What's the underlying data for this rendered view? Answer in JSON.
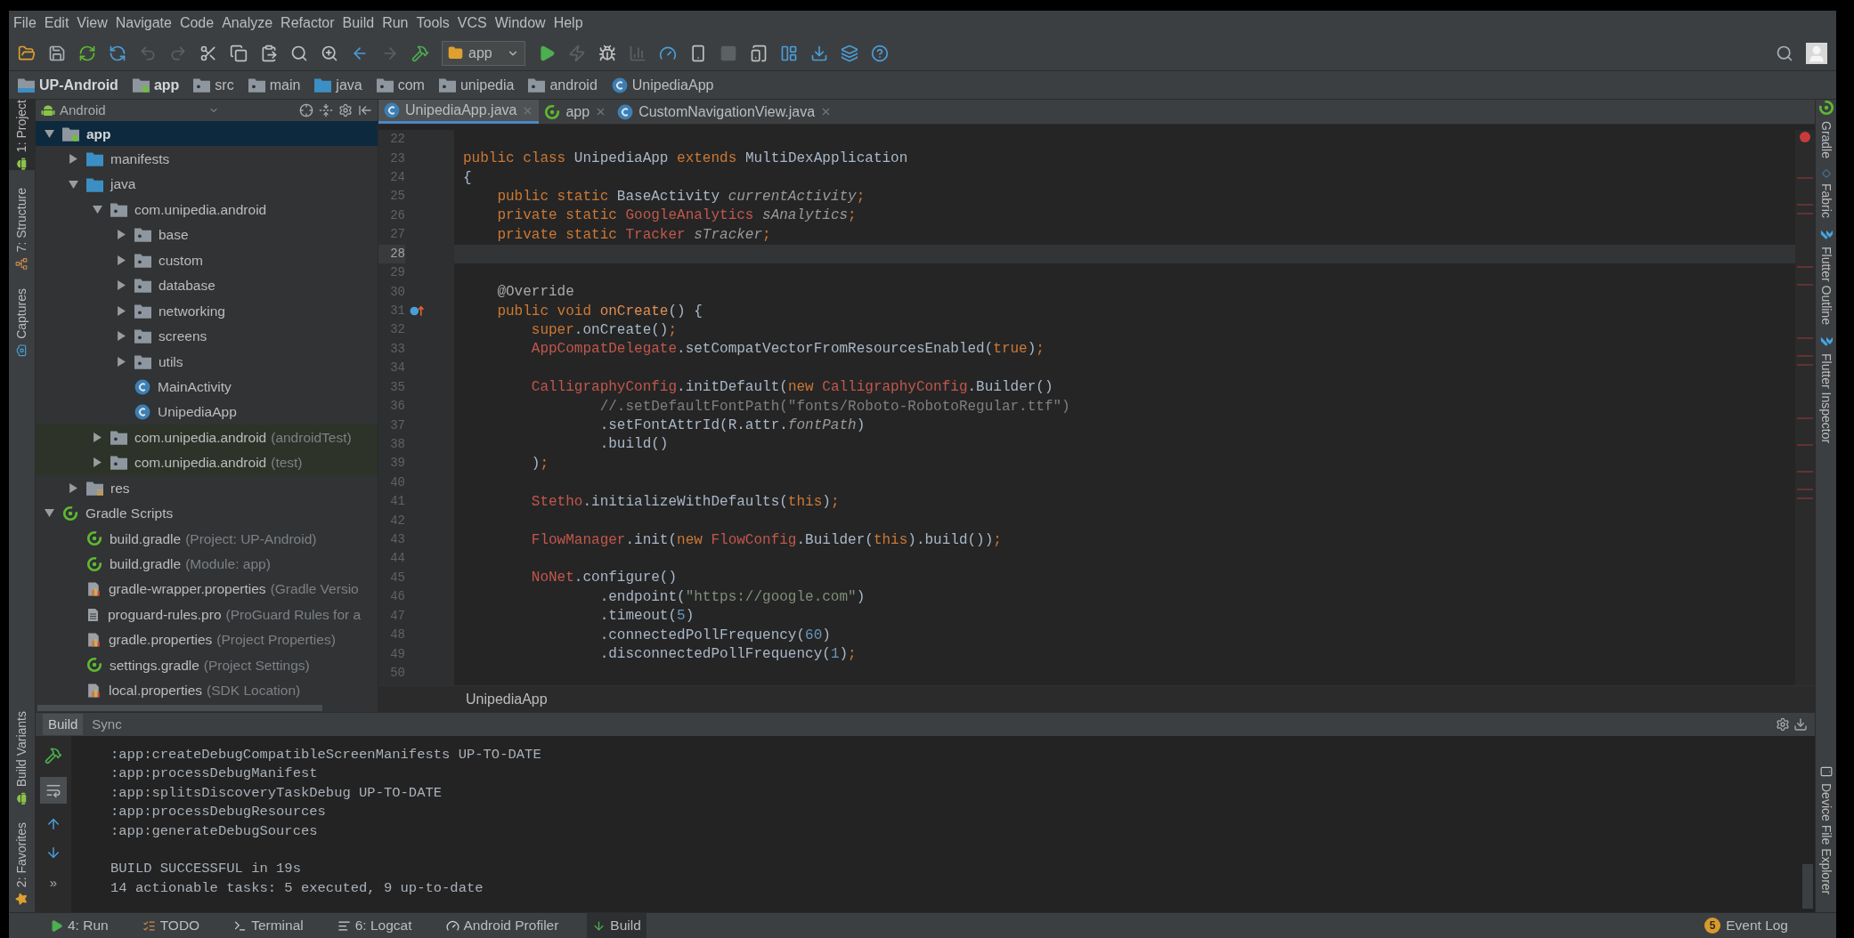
{
  "menu": [
    "File",
    "Edit",
    "View",
    "Navigate",
    "Code",
    "Analyze",
    "Refactor",
    "Build",
    "Run",
    "Tools",
    "VCS",
    "Window",
    "Help"
  ],
  "toolbar": {
    "run_config": "app"
  },
  "breadcrumb": [
    {
      "label": "UP-Android",
      "kind": "project"
    },
    {
      "label": "app",
      "kind": "module"
    },
    {
      "label": "src",
      "kind": "folder"
    },
    {
      "label": "main",
      "kind": "folder"
    },
    {
      "label": "java",
      "kind": "source"
    },
    {
      "label": "com",
      "kind": "package"
    },
    {
      "label": "unipedia",
      "kind": "package"
    },
    {
      "label": "android",
      "kind": "package"
    },
    {
      "label": "UnipediaApp",
      "kind": "class"
    }
  ],
  "left_stripe": {
    "top": [
      {
        "label": "1: Project",
        "kind": "project",
        "selected": true
      },
      {
        "label": "7: Structure",
        "kind": "structure",
        "selected": false
      },
      {
        "label": "Captures",
        "kind": "captures",
        "selected": false
      }
    ],
    "bottom": [
      {
        "label": "Build Variants",
        "kind": "variants",
        "selected": false
      },
      {
        "label": "2: Favorites",
        "kind": "favorites",
        "selected": false
      }
    ]
  },
  "right_stripe": {
    "top": [
      {
        "label": "Gradle",
        "kind": "gradle"
      },
      {
        "label": "Fabric",
        "kind": "fabric"
      },
      {
        "label": "Flutter Outline",
        "kind": "flutter"
      },
      {
        "label": "Flutter Inspector",
        "kind": "flutter"
      }
    ],
    "bottom": [
      {
        "label": "Device File Explorer",
        "kind": "device"
      }
    ]
  },
  "project": {
    "view": "Android",
    "tree": [
      {
        "label": "app",
        "kind": "module",
        "expanded": true,
        "selected": true,
        "children": [
          {
            "label": "manifests",
            "kind": "folder",
            "expanded": false,
            "selected": false
          },
          {
            "label": "java",
            "kind": "folder",
            "expanded": true,
            "selected": false,
            "children": [
              {
                "label": "com.unipedia.android",
                "kind": "package",
                "expanded": true,
                "selected": false,
                "children": [
                  {
                    "label": "base",
                    "kind": "package",
                    "expanded": false,
                    "selected": false
                  },
                  {
                    "label": "custom",
                    "kind": "package",
                    "expanded": false,
                    "selected": false
                  },
                  {
                    "label": "database",
                    "kind": "package",
                    "expanded": false,
                    "selected": false
                  },
                  {
                    "label": "networking",
                    "kind": "package",
                    "expanded": false,
                    "selected": false
                  },
                  {
                    "label": "screens",
                    "kind": "package",
                    "expanded": false,
                    "selected": false
                  },
                  {
                    "label": "utils",
                    "kind": "package",
                    "expanded": false,
                    "selected": false
                  },
                  {
                    "label": "MainActivity",
                    "kind": "class",
                    "selected": false
                  },
                  {
                    "label": "UnipediaApp",
                    "kind": "class",
                    "selected": false
                  }
                ]
              },
              {
                "label": "com.unipedia.android",
                "note": "(androidTest)",
                "kind": "test-package",
                "expanded": false,
                "selected": false
              },
              {
                "label": "com.unipedia.android",
                "note": "(test)",
                "kind": "test-package",
                "expanded": false,
                "selected": false
              }
            ]
          },
          {
            "label": "res",
            "kind": "res",
            "expanded": false,
            "selected": false
          }
        ]
      },
      {
        "label": "Gradle Scripts",
        "kind": "gradle",
        "expanded": true,
        "selected": false,
        "children": [
          {
            "label": "build.gradle",
            "note": "(Project: UP-Android)",
            "kind": "gradle",
            "selected": false
          },
          {
            "label": "build.gradle",
            "note": "(Module: app)",
            "kind": "gradle",
            "selected": false
          },
          {
            "label": "gradle-wrapper.properties",
            "note": "(Gradle Versio",
            "kind": "properties",
            "selected": false
          },
          {
            "label": "proguard-rules.pro",
            "note": "(ProGuard Rules for a",
            "kind": "file",
            "selected": false
          },
          {
            "label": "gradle.properties",
            "note": "(Project Properties)",
            "kind": "properties",
            "selected": false
          },
          {
            "label": "settings.gradle",
            "note": "(Project Settings)",
            "kind": "gradle",
            "selected": false
          },
          {
            "label": "local.properties",
            "note": "(SDK Location)",
            "kind": "properties",
            "selected": false
          }
        ]
      }
    ]
  },
  "editor": {
    "tabs": [
      {
        "label": "UnipediaApp.java",
        "kind": "class",
        "selected": true
      },
      {
        "label": "app",
        "kind": "gradle",
        "selected": false
      },
      {
        "label": "CustomNavigationView.java",
        "kind": "class",
        "selected": false
      }
    ],
    "lines": [
      {
        "number": "22",
        "kind": "code",
        "current": false
      },
      {
        "number": "23",
        "kind": "code",
        "current": false,
        "tokens": [
          {
            "kind": "kw",
            "text": "public class "
          },
          {
            "kind": "plain",
            "text": "UnipediaApp"
          },
          {
            "kind": "kw",
            "text": " extends "
          },
          {
            "kind": "plain",
            "text": "MultiDexApplication"
          }
        ]
      },
      {
        "number": "24",
        "kind": "code",
        "current": false,
        "tokens": [
          {
            "kind": "plain",
            "text": "{"
          }
        ]
      },
      {
        "number": "25",
        "kind": "code",
        "current": false,
        "tokens": [
          {
            "kind": "kw",
            "text": "    public static "
          },
          {
            "kind": "plain",
            "text": "BaseActivity "
          },
          {
            "kind": "field",
            "text": "currentActivity"
          },
          {
            "kind": "kw",
            "text": ";"
          }
        ]
      },
      {
        "number": "26",
        "kind": "code",
        "current": false,
        "tokens": [
          {
            "kind": "kw",
            "text": "    private static "
          },
          {
            "kind": "error",
            "text": "GoogleAnalytics "
          },
          {
            "kind": "field",
            "text": "sAnalytics"
          },
          {
            "kind": "kw",
            "text": ";"
          }
        ]
      },
      {
        "number": "27",
        "kind": "code",
        "current": false,
        "tokens": [
          {
            "kind": "kw",
            "text": "    private static "
          },
          {
            "kind": "error",
            "text": "Tracker "
          },
          {
            "kind": "field",
            "text": "sTracker"
          },
          {
            "kind": "kw",
            "text": ";"
          }
        ]
      },
      {
        "number": "28",
        "kind": "code",
        "current": true
      },
      {
        "number": "29",
        "kind": "code",
        "current": false
      },
      {
        "number": "30",
        "kind": "code",
        "current": false,
        "tokens": [
          {
            "kind": "annotation",
            "text": "    @Override"
          }
        ]
      },
      {
        "number": "31",
        "kind": "override",
        "current": false,
        "tokens": [
          {
            "kind": "kw",
            "text": "    public void "
          },
          {
            "kind": "method",
            "text": "onCreate"
          },
          {
            "kind": "plain",
            "text": "() {"
          }
        ]
      },
      {
        "number": "32",
        "kind": "code",
        "current": false,
        "tokens": [
          {
            "kind": "kw",
            "text": "        super"
          },
          {
            "kind": "plain",
            "text": ".onCreate()"
          },
          {
            "kind": "kw",
            "text": ";"
          }
        ]
      },
      {
        "number": "33",
        "kind": "code",
        "current": false,
        "tokens": [
          {
            "kind": "error",
            "text": "        AppCompatDelegate"
          },
          {
            "kind": "plain",
            "text": ".setCompatVectorFromResourcesEnabled("
          },
          {
            "kind": "kw",
            "text": "true"
          },
          {
            "kind": "plain",
            "text": ")"
          },
          {
            "kind": "kw",
            "text": ";"
          }
        ]
      },
      {
        "number": "34",
        "kind": "code",
        "current": false
      },
      {
        "number": "35",
        "kind": "code",
        "current": false,
        "tokens": [
          {
            "kind": "error",
            "text": "        CalligraphyConfig"
          },
          {
            "kind": "plain",
            "text": ".initDefault("
          },
          {
            "kind": "kw",
            "text": "new "
          },
          {
            "kind": "error",
            "text": "CalligraphyConfig"
          },
          {
            "kind": "plain",
            "text": ".Builder()"
          }
        ]
      },
      {
        "number": "36",
        "kind": "code",
        "current": false,
        "tokens": [
          {
            "kind": "comment",
            "text": "                //.setDefaultFontPath(\"fonts/Roboto-RobotoRegular.ttf\")"
          }
        ]
      },
      {
        "number": "37",
        "kind": "code",
        "current": false,
        "tokens": [
          {
            "kind": "plain",
            "text": "                .setFontAttrId(R.attr."
          },
          {
            "kind": "field",
            "text": "fontPath"
          },
          {
            "kind": "plain",
            "text": ")"
          }
        ]
      },
      {
        "number": "38",
        "kind": "code",
        "current": false,
        "tokens": [
          {
            "kind": "plain",
            "text": "                .build()"
          }
        ]
      },
      {
        "number": "39",
        "kind": "code",
        "current": false,
        "tokens": [
          {
            "kind": "plain",
            "text": "        )"
          },
          {
            "kind": "kw",
            "text": ";"
          }
        ]
      },
      {
        "number": "40",
        "kind": "code",
        "current": false
      },
      {
        "number": "41",
        "kind": "code",
        "current": false,
        "tokens": [
          {
            "kind": "error",
            "text": "        Stetho"
          },
          {
            "kind": "plain",
            "text": ".initializeWithDefaults("
          },
          {
            "kind": "kw",
            "text": "this"
          },
          {
            "kind": "plain",
            "text": ")"
          },
          {
            "kind": "kw",
            "text": ";"
          }
        ]
      },
      {
        "number": "42",
        "kind": "code",
        "current": false
      },
      {
        "number": "43",
        "kind": "code",
        "current": false,
        "tokens": [
          {
            "kind": "error",
            "text": "        FlowManager"
          },
          {
            "kind": "plain",
            "text": ".init("
          },
          {
            "kind": "kw",
            "text": "new "
          },
          {
            "kind": "error",
            "text": "FlowConfig"
          },
          {
            "kind": "plain",
            "text": ".Builder("
          },
          {
            "kind": "kw",
            "text": "this"
          },
          {
            "kind": "plain",
            "text": ").build())"
          },
          {
            "kind": "kw",
            "text": ";"
          }
        ]
      },
      {
        "number": "44",
        "kind": "code",
        "current": false
      },
      {
        "number": "45",
        "kind": "code",
        "current": false,
        "tokens": [
          {
            "kind": "error",
            "text": "        NoNet"
          },
          {
            "kind": "plain",
            "text": ".configure()"
          }
        ]
      },
      {
        "number": "46",
        "kind": "code",
        "current": false,
        "tokens": [
          {
            "kind": "plain",
            "text": "                .endpoint("
          },
          {
            "kind": "string",
            "text": "\"https://google.com\""
          },
          {
            "kind": "plain",
            "text": ")"
          }
        ]
      },
      {
        "number": "47",
        "kind": "code",
        "current": false,
        "tokens": [
          {
            "kind": "plain",
            "text": "                .timeout("
          },
          {
            "kind": "number",
            "text": "5"
          },
          {
            "kind": "plain",
            "text": ")"
          }
        ]
      },
      {
        "number": "48",
        "kind": "code",
        "current": false,
        "tokens": [
          {
            "kind": "plain",
            "text": "                .connectedPollFrequency("
          },
          {
            "kind": "number",
            "text": "60"
          },
          {
            "kind": "plain",
            "text": ")"
          }
        ]
      },
      {
        "number": "49",
        "kind": "code",
        "current": false,
        "tokens": [
          {
            "kind": "plain",
            "text": "                .disconnectedPollFrequency("
          },
          {
            "kind": "number",
            "text": "1"
          },
          {
            "kind": "plain",
            "text": ")"
          },
          {
            "kind": "kw",
            "text": ";"
          }
        ]
      },
      {
        "number": "50",
        "kind": "code",
        "current": false
      }
    ],
    "footer": "UnipediaApp"
  },
  "build_panel": {
    "tabs": [
      {
        "label": "Build",
        "selected": true
      },
      {
        "label": "Sync",
        "selected": false
      }
    ],
    "more": "»",
    "output_blocks": [
      [
        ":app:createDebugCompatibleScreenManifests UP-TO-DATE",
        ":app:processDebugManifest",
        ":app:splitsDiscoveryTaskDebug UP-TO-DATE",
        ":app:processDebugResources",
        ":app:generateDebugSources"
      ],
      [
        "BUILD SUCCESSFUL in 19s",
        "14 actionable tasks: 5 executed, 9 up-to-date"
      ]
    ]
  },
  "status_bar": {
    "tools": [
      {
        "label": "4: Run",
        "kind": "run",
        "selected": false
      },
      {
        "label": "TODO",
        "kind": "todo",
        "selected": false
      },
      {
        "label": "Terminal",
        "kind": "terminal",
        "selected": false
      },
      {
        "label": "6: Logcat",
        "kind": "logcat",
        "selected": false
      },
      {
        "label": "Android Profiler",
        "kind": "profiler",
        "selected": false
      },
      {
        "label": "Build",
        "kind": "build",
        "selected": true
      }
    ],
    "event_log": {
      "label": "Event Log",
      "count": "5"
    }
  }
}
